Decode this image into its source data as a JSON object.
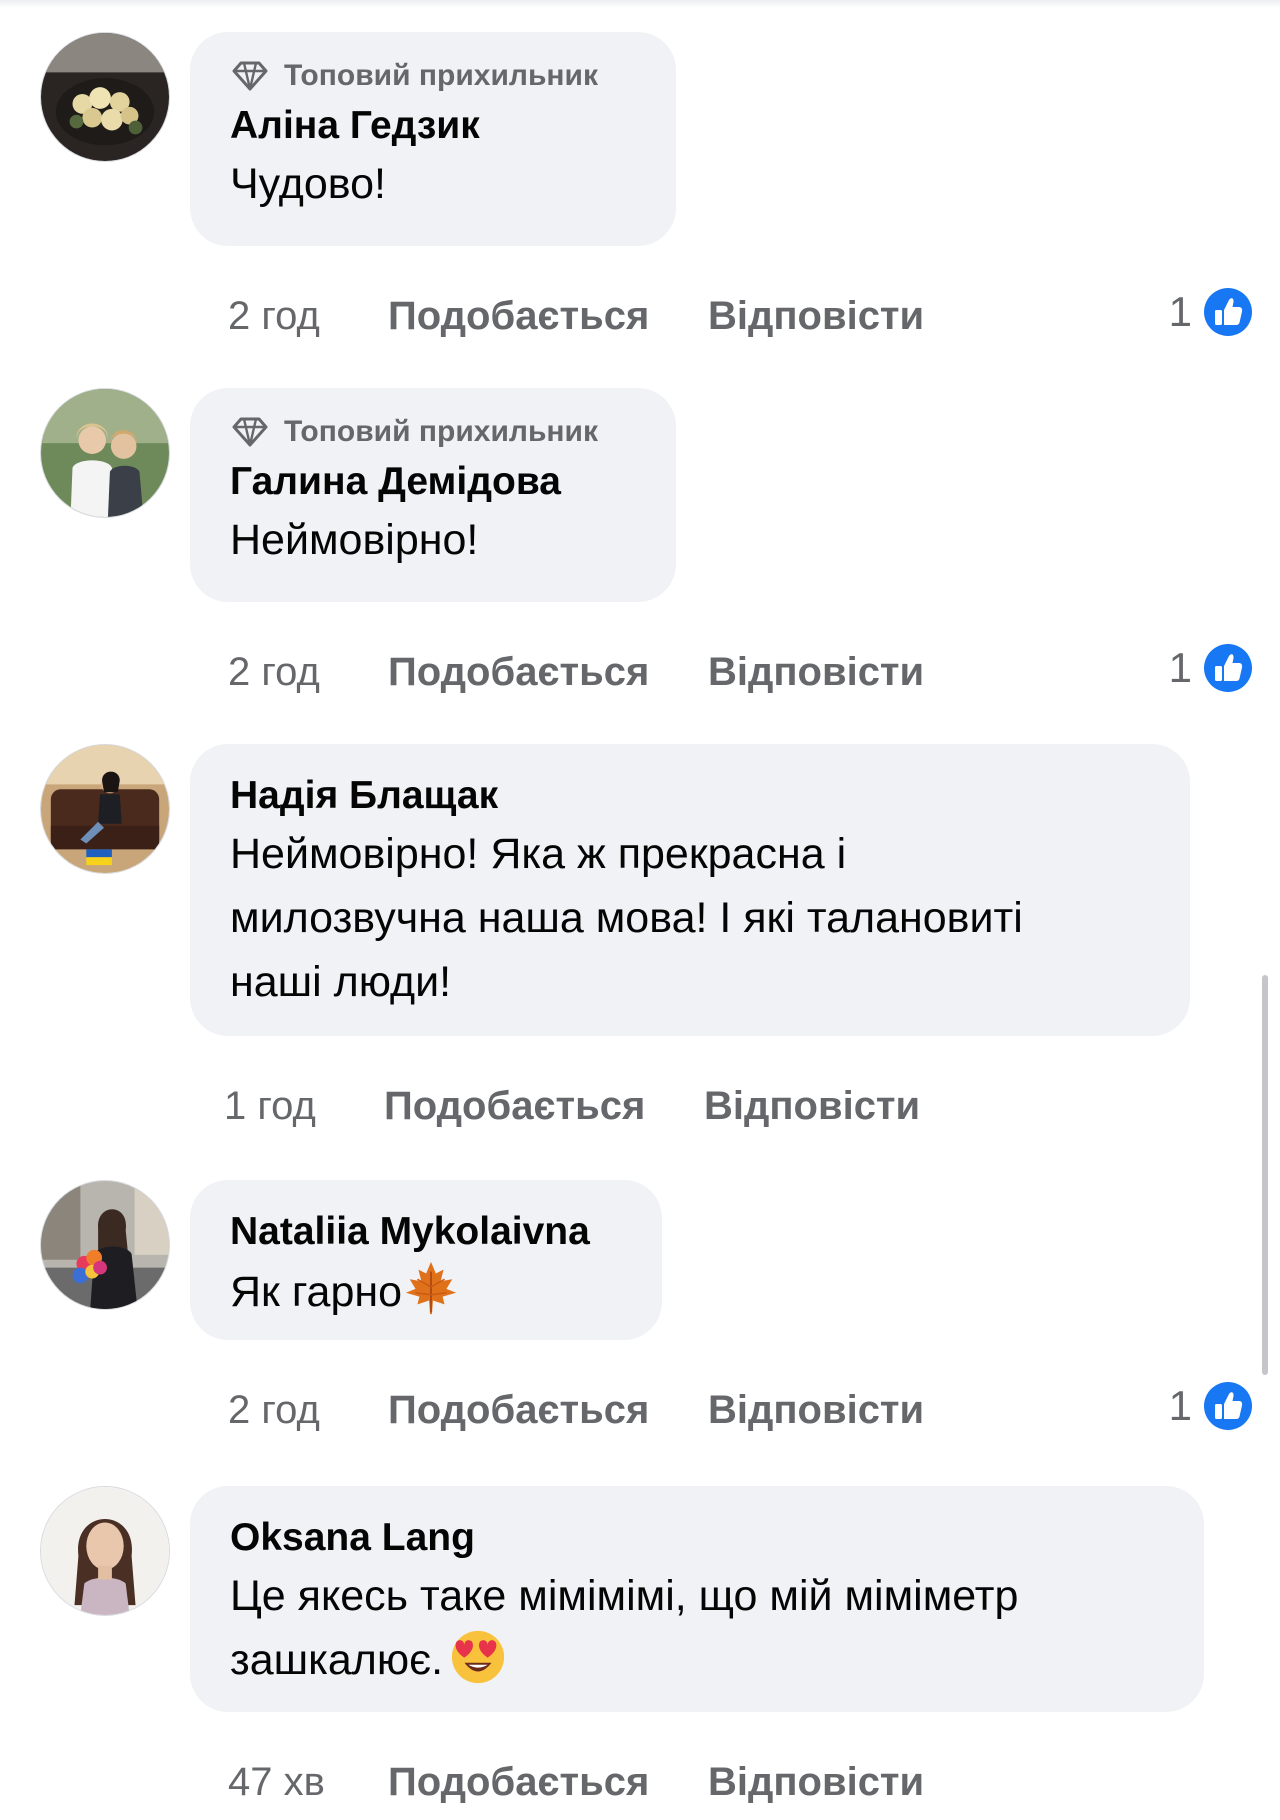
{
  "comments": [
    {
      "badge": "Топовий прихильник",
      "name": "Аліна Гедзик",
      "lines": [
        "Чудово!"
      ],
      "time": "2 год",
      "like_label": "Подобається",
      "reply_label": "Відповісти",
      "reactions": "1",
      "reaction_icon": "like-icon"
    },
    {
      "badge": "Топовий прихильник",
      "name": "Галина Демідова",
      "lines": [
        "Неймовірно!"
      ],
      "time": "2 год",
      "like_label": "Подобається",
      "reply_label": "Відповісти",
      "reactions": "1",
      "reaction_icon": "like-icon"
    },
    {
      "name": "Надія Блащак",
      "lines": [
        "Неймовірно! Яка ж прекрасна і",
        "милозвучна наша мова! І які талановиті",
        "наші люди!"
      ],
      "time": "1 год",
      "like_label": "Подобається",
      "reply_label": "Відповісти"
    },
    {
      "name": "Nataliia Mykolaivna",
      "lines": [
        "Як гарно"
      ],
      "emoji": "maple-leaf-emoji",
      "time": "2 год",
      "like_label": "Подобається",
      "reply_label": "Відповісти",
      "reactions": "1",
      "reaction_icon": "like-icon"
    },
    {
      "name": "Oksana Lang",
      "lines": [
        "Це якесь таке мімімімі, що мій міміметр",
        "зашкалює."
      ],
      "emoji": "heart-eyes-emoji",
      "time": "47 хв",
      "like_label": "Подобається",
      "reply_label": "Відповісти"
    }
  ],
  "colors": {
    "bubble": "#f0f2f5",
    "secondary_text": "#65676b",
    "like_blue": "#1877f2"
  }
}
